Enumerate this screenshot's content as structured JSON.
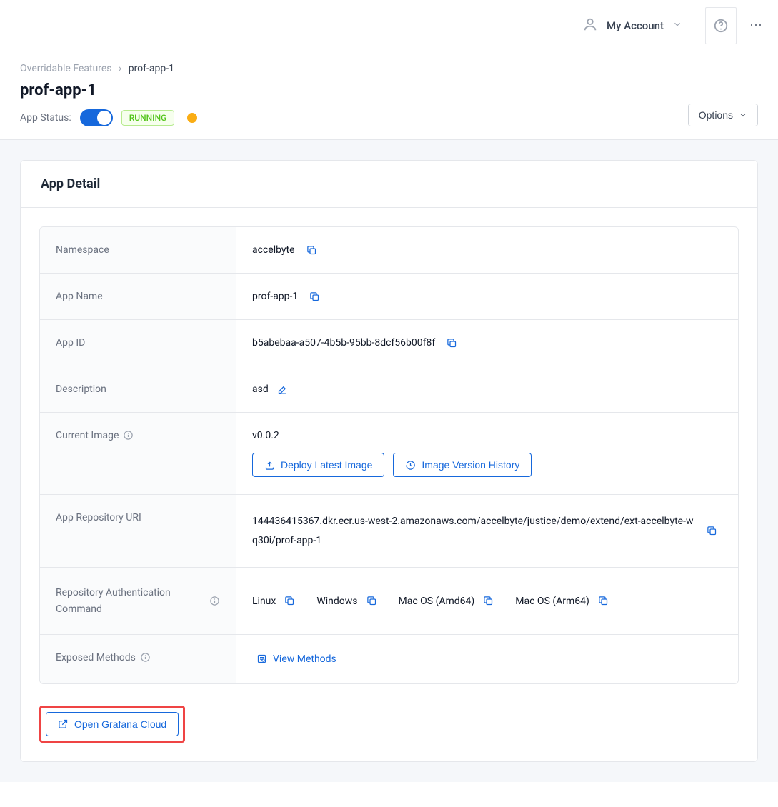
{
  "topbar": {
    "account": "My Account"
  },
  "breadcrumb": {
    "root": "Overridable Features",
    "current": "prof-app-1"
  },
  "page": {
    "title": "prof-app-1",
    "status_label": "App Status:",
    "running_badge": "RUNNING",
    "options_btn": "Options"
  },
  "card": {
    "title": "App Detail"
  },
  "fields": {
    "namespace": {
      "label": "Namespace",
      "value": "accelbyte"
    },
    "app_name": {
      "label": "App Name",
      "value": "prof-app-1"
    },
    "app_id": {
      "label": "App ID",
      "value": "b5abebaa-a507-4b5b-95bb-8dcf56b00f8f"
    },
    "description": {
      "label": "Description",
      "value": "asd"
    },
    "current_image": {
      "label": "Current Image",
      "value": "v0.0.2",
      "deploy_btn": "Deploy Latest Image",
      "history_btn": "Image Version History"
    },
    "repo_uri": {
      "label": "App Repository URI",
      "value": "144436415367.dkr.ecr.us-west-2.amazonaws.com/accelbyte/justice/demo/extend/ext-accelbyte-wq30i/prof-app-1"
    },
    "repo_auth": {
      "label": "Repository Authentication Command",
      "linux": "Linux",
      "windows": "Windows",
      "mac_amd": "Mac OS (Amd64)",
      "mac_arm": "Mac OS (Arm64)"
    },
    "exposed": {
      "label": "Exposed Methods",
      "view_btn": "View Methods"
    }
  },
  "grafana": {
    "label": "Open Grafana Cloud"
  }
}
